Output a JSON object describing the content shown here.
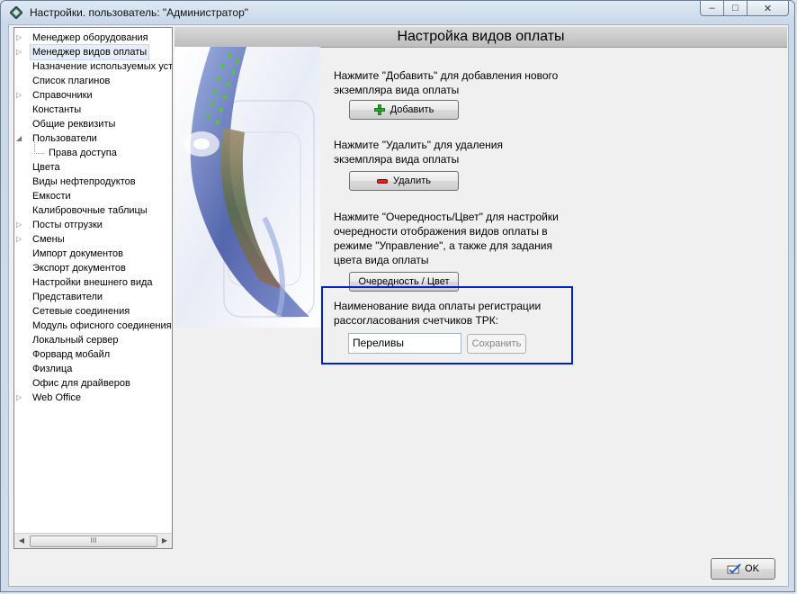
{
  "window": {
    "title": "Настройки. пользователь: \"Администратор\"",
    "caption_minimize": "–",
    "caption_maximize": "□",
    "caption_close": "✕"
  },
  "tree": {
    "items": [
      {
        "label": "Менеджер оборудования",
        "arrow": "▷"
      },
      {
        "label": "Менеджер видов оплаты",
        "arrow": "▷",
        "selected": true
      },
      {
        "label": "Назначение используемых уст",
        "arrow": ""
      },
      {
        "label": "Список плагинов",
        "arrow": ""
      },
      {
        "label": "Справочники",
        "arrow": "▷"
      },
      {
        "label": "Константы",
        "arrow": ""
      },
      {
        "label": "Общие реквизиты",
        "arrow": ""
      },
      {
        "label": "Пользователи",
        "arrow": "◢"
      },
      {
        "label": "Права доступа",
        "arrow": "",
        "child": true
      },
      {
        "label": "Цвета",
        "arrow": ""
      },
      {
        "label": "Виды нефтепродуктов",
        "arrow": ""
      },
      {
        "label": "Емкости",
        "arrow": ""
      },
      {
        "label": "Калибровочные таблицы",
        "arrow": ""
      },
      {
        "label": "Посты отгрузки",
        "arrow": "▷"
      },
      {
        "label": "Смены",
        "arrow": "▷"
      },
      {
        "label": "Импорт документов",
        "arrow": ""
      },
      {
        "label": "Экспорт документов",
        "arrow": ""
      },
      {
        "label": "Настройки внешнего вида",
        "arrow": ""
      },
      {
        "label": "Представители",
        "arrow": ""
      },
      {
        "label": "Сетевые соединения",
        "arrow": ""
      },
      {
        "label": "Модуль офисного соединения",
        "arrow": ""
      },
      {
        "label": "Локальный сервер",
        "arrow": ""
      },
      {
        "label": "Форвард мобайл",
        "arrow": ""
      },
      {
        "label": "Физлица",
        "arrow": ""
      },
      {
        "label": "Офис для драйверов",
        "arrow": ""
      },
      {
        "label": "Web Office",
        "arrow": "▷"
      }
    ],
    "scroll_left": "◀",
    "scroll_right": "▶",
    "scroll_grip": "III"
  },
  "panel": {
    "header": "Настройка видов оплаты",
    "add_instruction": [
      "Нажмите \"Добавить\" для добавления нового",
      "экземпляра вида оплаты"
    ],
    "add_button": "Добавить",
    "delete_instruction": [
      "Нажмите \"Удалить\" для удаления",
      "экземпляра вида оплаты"
    ],
    "delete_button": "Удалить",
    "order_instruction": [
      "Нажмите \"Очередность/Цвет\" для настройки",
      "очередности отображения видов оплаты в",
      "режиме \"Управление\", а также для задания",
      "цвета вида оплаты"
    ],
    "order_button": "Очередность / Цвет",
    "name_label": [
      "Наименование вида оплаты регистрации",
      "рассогласования счетчиков ТРК:"
    ],
    "name_value": "Переливы",
    "save_button": "Сохранить"
  },
  "footer": {
    "ok_button": "OK"
  },
  "colors": {
    "highlight_border": "#0022cc",
    "header_bg": "#c9c9c9"
  }
}
